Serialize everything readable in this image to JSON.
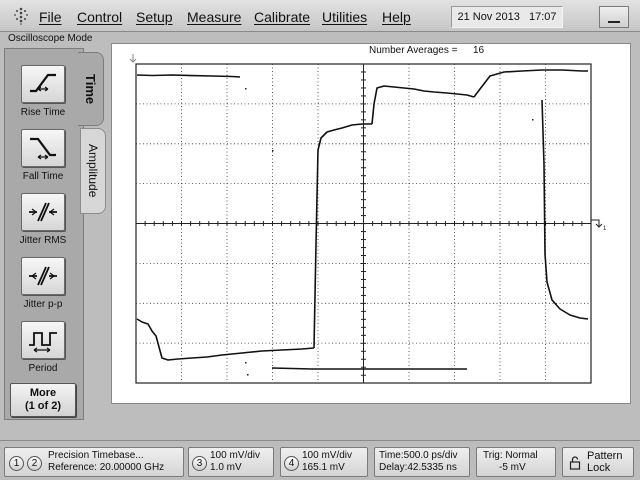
{
  "menu": {
    "items": [
      {
        "label": "File"
      },
      {
        "label": "Control"
      },
      {
        "label": "Setup"
      },
      {
        "label": "Measure"
      },
      {
        "label": "Calibrate"
      },
      {
        "label": "Utilities"
      },
      {
        "label": "Help"
      }
    ],
    "date": "21 Nov 2013",
    "time": "17:07"
  },
  "mode_label": "Oscilloscope Mode",
  "measure_panel": {
    "buttons": [
      {
        "label": "Rise Time",
        "icon": "rise-time-icon"
      },
      {
        "label": "Fall Time",
        "icon": "fall-time-icon"
      },
      {
        "label": "Jitter RMS",
        "icon": "jitter-rms-icon"
      },
      {
        "label": "Jitter p-p",
        "icon": "jitter-pp-icon"
      },
      {
        "label": "Period",
        "icon": "period-icon"
      }
    ],
    "more_label": "More",
    "more_page": "(1 of 2)",
    "tabs": [
      {
        "label": "Time"
      },
      {
        "label": "Amplitude"
      }
    ]
  },
  "display": {
    "averages_label": "Number Averages =",
    "averages_value": "16",
    "marker_label": "1"
  },
  "status": {
    "timebase": {
      "channels": [
        "1",
        "2"
      ],
      "line1": "Precision Timebase...",
      "line2": "Reference: 20.00000 GHz"
    },
    "ch3": {
      "number": "3",
      "line1": "100 mV/div",
      "line2": "1.0 mV"
    },
    "ch4": {
      "number": "4",
      "line1": "100 mV/div",
      "line2": "165.1 mV"
    },
    "horizontal": {
      "line1": "Time:500.0 ps/div",
      "line2": "Delay:42.5335 ns"
    },
    "trigger": {
      "line1": "Trig: Normal",
      "line2": "-5 mV"
    },
    "pattern": {
      "line1": "Pattern",
      "line2": "Lock"
    }
  },
  "colors": {
    "trace": "#111111",
    "grid": "#222222",
    "screen": "#ffffff"
  }
}
